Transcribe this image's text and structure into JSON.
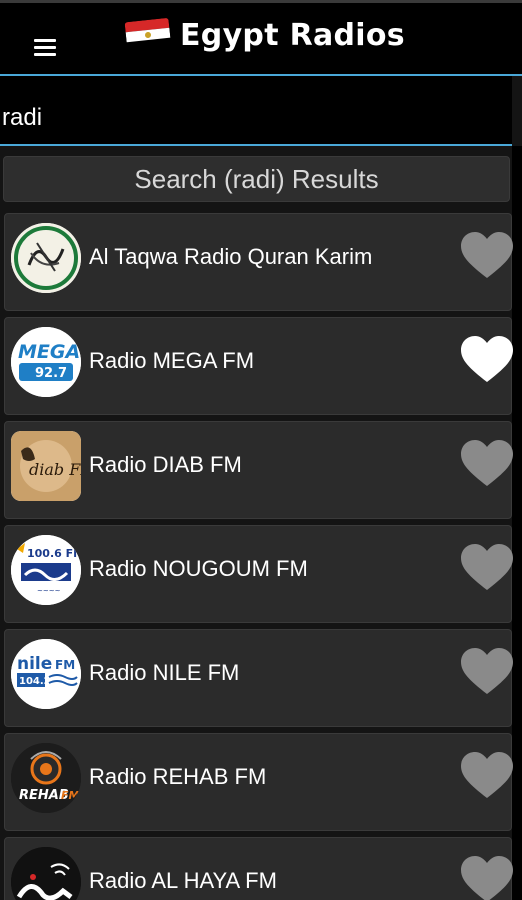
{
  "header": {
    "title": "Egypt Radios",
    "menu_icon": "hamburger-menu-icon",
    "flag_icon": "egypt-flag-icon"
  },
  "search": {
    "value": "radi"
  },
  "results": {
    "header": "Search (radi) Results"
  },
  "colors": {
    "accent": "#4aa8d8",
    "row_bg": "#2b2b2b",
    "favorite_on": "#ffffff",
    "favorite_off": "#8a8a8a"
  },
  "stations": [
    {
      "name": "Al Taqwa Radio Quran Karim",
      "favorite": false,
      "logo_icon": "quran-calligraphy-logo"
    },
    {
      "name": "Radio MEGA FM",
      "favorite": true,
      "logo_icon": "mega-fm-logo"
    },
    {
      "name": "Radio DIAB FM",
      "favorite": false,
      "logo_icon": "diab-fm-logo"
    },
    {
      "name": "Radio NOUGOUM FM",
      "favorite": false,
      "logo_icon": "nougoum-fm-logo"
    },
    {
      "name": "Radio NILE FM",
      "favorite": false,
      "logo_icon": "nile-fm-logo"
    },
    {
      "name": "Radio REHAB FM",
      "favorite": false,
      "logo_icon": "rehab-fm-logo"
    },
    {
      "name": "Radio AL HAYA FM",
      "favorite": false,
      "logo_icon": "al-haya-fm-logo"
    }
  ]
}
